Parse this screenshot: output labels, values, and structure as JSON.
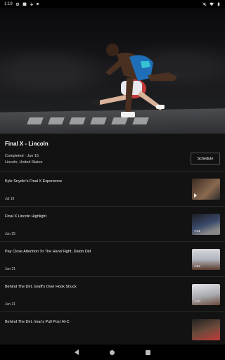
{
  "status": {
    "time": "1:19"
  },
  "event": {
    "title": "Final X - Lincoln",
    "status": "Completed - Jun 15",
    "location": "Lincoln, United States",
    "schedule_label": "Schedule"
  },
  "videos": [
    {
      "title": "Kyle Snyder's Final X Experience",
      "date": "Jul 19",
      "duration": ""
    },
    {
      "title": "Final X Lincoln Highlight",
      "date": "Jun 25",
      "duration": "7:41"
    },
    {
      "title": "Pay Close Attention To The Hand Fight, Daton Did",
      "date": "Jun 21",
      "duration": "4:52"
    },
    {
      "title": "Behind The Dirt, Graff's Over Hook Shuck",
      "date": "Jun 21",
      "duration": "1:10"
    },
    {
      "title": "Behind The Dirt, Imar's Pull Post Hi-C",
      "date": "",
      "duration": ""
    }
  ]
}
